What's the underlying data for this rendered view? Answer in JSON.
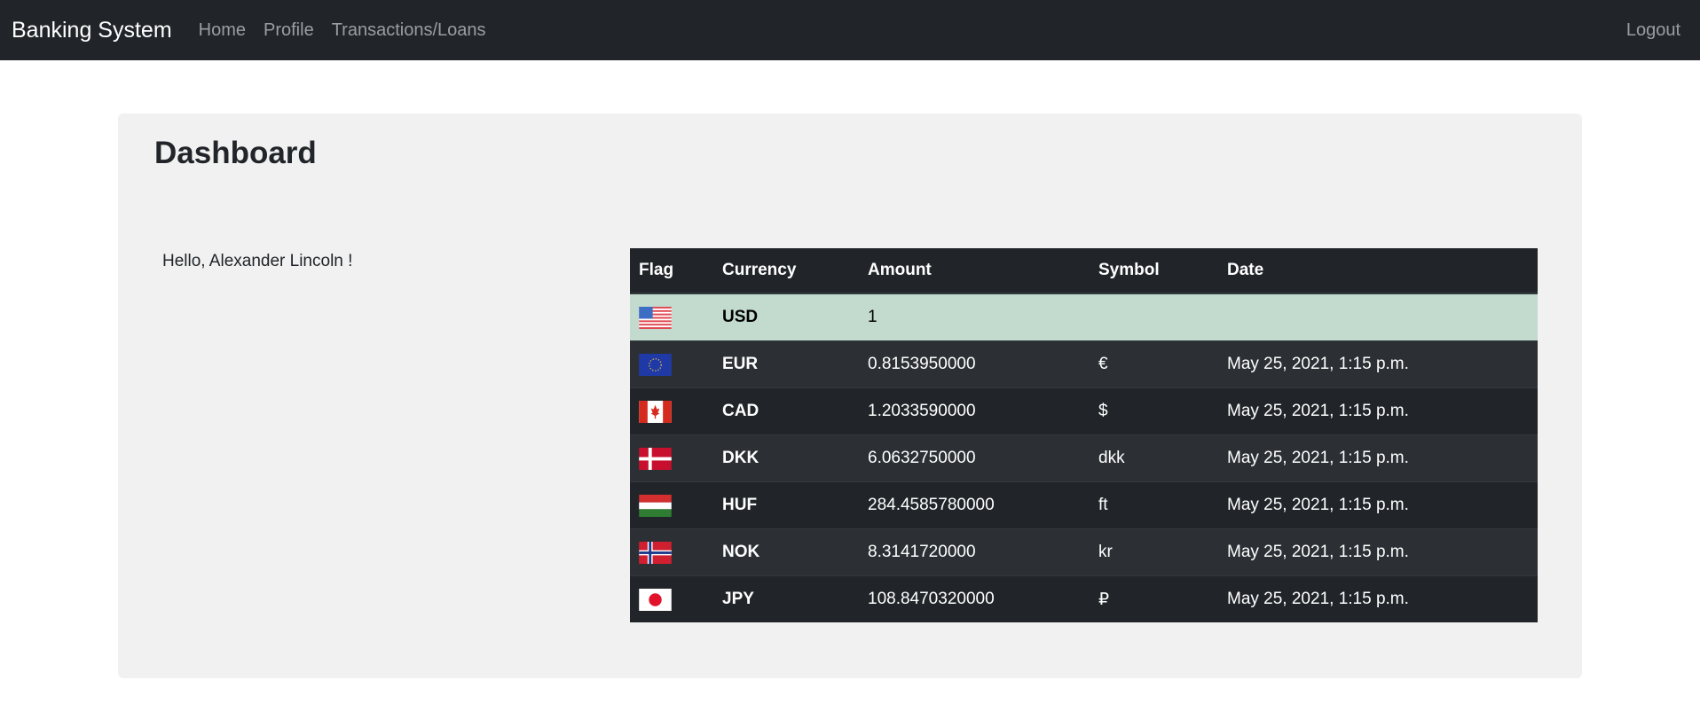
{
  "navbar": {
    "brand": "Banking System",
    "links": [
      "Home",
      "Profile",
      "Transactions/Loans"
    ],
    "logout": "Logout"
  },
  "page": {
    "title": "Dashboard",
    "greeting": "Hello, Alexander Lincoln !"
  },
  "table": {
    "headers": [
      "Flag",
      "Currency",
      "Amount",
      "Symbol",
      "Date"
    ],
    "rows": [
      {
        "flag": "us-flag-icon",
        "currency": "USD",
        "amount": "1",
        "symbol": "",
        "date": ""
      },
      {
        "flag": "eu-flag-icon",
        "currency": "EUR",
        "amount": "0.8153950000",
        "symbol": "€",
        "date": "May 25, 2021, 1:15 p.m."
      },
      {
        "flag": "ca-flag-icon",
        "currency": "CAD",
        "amount": "1.2033590000",
        "symbol": "$",
        "date": "May 25, 2021, 1:15 p.m."
      },
      {
        "flag": "dk-flag-icon",
        "currency": "DKK",
        "amount": "6.0632750000",
        "symbol": "dkk",
        "date": "May 25, 2021, 1:15 p.m."
      },
      {
        "flag": "hu-flag-icon",
        "currency": "HUF",
        "amount": "284.4585780000",
        "symbol": "ft",
        "date": "May 25, 2021, 1:15 p.m."
      },
      {
        "flag": "no-flag-icon",
        "currency": "NOK",
        "amount": "8.3141720000",
        "symbol": "kr",
        "date": "May 25, 2021, 1:15 p.m."
      },
      {
        "flag": "jp-flag-icon",
        "currency": "JPY",
        "amount": "108.8470320000",
        "symbol": "₽",
        "date": "May 25, 2021, 1:15 p.m."
      }
    ]
  },
  "colors": {
    "navbar_bg": "#212529",
    "table_bg": "#212529",
    "table_stripe": "#2c3034",
    "highlight_row": "#c3dbcf",
    "panel_bg": "#f1f1f1"
  }
}
